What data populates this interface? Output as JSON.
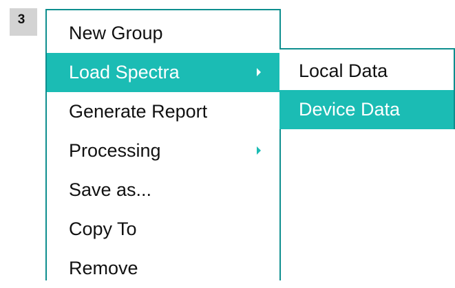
{
  "step_badge": "3",
  "menu": {
    "items": [
      {
        "label": "New Group",
        "active": false,
        "has_submenu": false
      },
      {
        "label": "Load Spectra",
        "active": true,
        "has_submenu": true
      },
      {
        "label": "Generate Report",
        "active": false,
        "has_submenu": false
      },
      {
        "label": "Processing",
        "active": false,
        "has_submenu": true
      },
      {
        "label": "Save as...",
        "active": false,
        "has_submenu": false
      },
      {
        "label": "Copy To",
        "active": false,
        "has_submenu": false
      },
      {
        "label": "Remove",
        "active": false,
        "has_submenu": false
      }
    ]
  },
  "submenu": {
    "items": [
      {
        "label": "Local Data",
        "active": false
      },
      {
        "label": "Device Data",
        "active": true
      }
    ]
  },
  "colors": {
    "highlight": "#1bbcb4",
    "border": "#0c8e8e",
    "badge_bg": "#d3d3d3"
  },
  "icons": {
    "submenu_arrow": "triangle-right-icon"
  }
}
